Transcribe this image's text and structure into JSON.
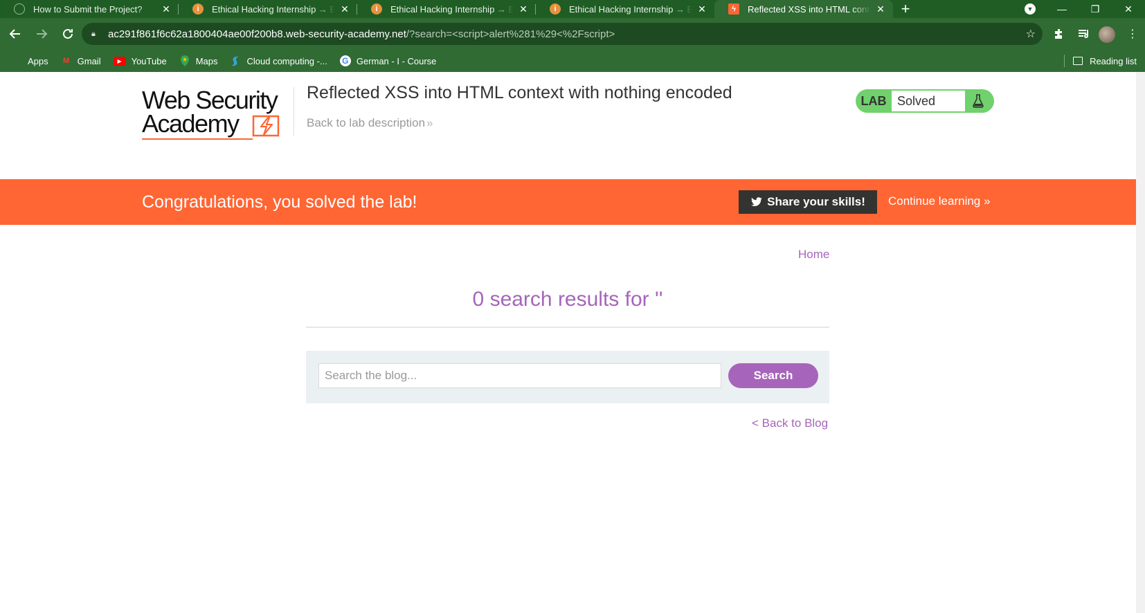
{
  "browser": {
    "tabs": [
      {
        "title": "How to Submit the Project?",
        "icon": "globe-icon",
        "active": false
      },
      {
        "title": "Ethical Hacking Internship → EH I",
        "icon": "internshala-icon",
        "active": false
      },
      {
        "title": "Ethical Hacking Internship → EH I",
        "icon": "internshala-icon",
        "active": false
      },
      {
        "title": "Ethical Hacking Internship → EH I",
        "icon": "internshala-icon",
        "active": false
      },
      {
        "title": "Reflected XSS into HTML context",
        "icon": "portswigger-icon",
        "active": true
      }
    ],
    "new_tab": "+",
    "address": {
      "host": "ac291f861f6c62a1800404ae00f200b8.web-security-academy.net",
      "path": "/?search=<script>alert%281%29<%2Fscript>"
    },
    "bookmarks": [
      {
        "label": "Apps",
        "icon": "apps-icon"
      },
      {
        "label": "Gmail",
        "icon": "gmail-icon"
      },
      {
        "label": "YouTube",
        "icon": "youtube-icon"
      },
      {
        "label": "Maps",
        "icon": "maps-icon"
      },
      {
        "label": "Cloud computing -...",
        "icon": "cloud-icon"
      },
      {
        "label": "German - I - Course",
        "icon": "google-icon"
      }
    ],
    "reading_list": "Reading list"
  },
  "header": {
    "logo_line1": "Web Security",
    "logo_line2": "Academy",
    "lab_title": "Reflected XSS into HTML context with nothing encoded",
    "back_to_description": "Back to lab description",
    "lab_badge": "LAB",
    "lab_status": "Solved"
  },
  "banner": {
    "message": "Congratulations, you solved the lab!",
    "share_label": "Share your skills!",
    "continue_label": "Continue learning"
  },
  "main": {
    "home_link": "Home",
    "results_heading": "0 search results for ''",
    "search_placeholder": "Search the blog...",
    "search_button": "Search",
    "back_to_blog": "< Back to Blog"
  },
  "colors": {
    "chrome_dark": "#1f5d24",
    "chrome": "#2f6b33",
    "accent_orange": "#ff6633",
    "link_purple": "#a665ba",
    "solved_green": "#70d16d"
  }
}
